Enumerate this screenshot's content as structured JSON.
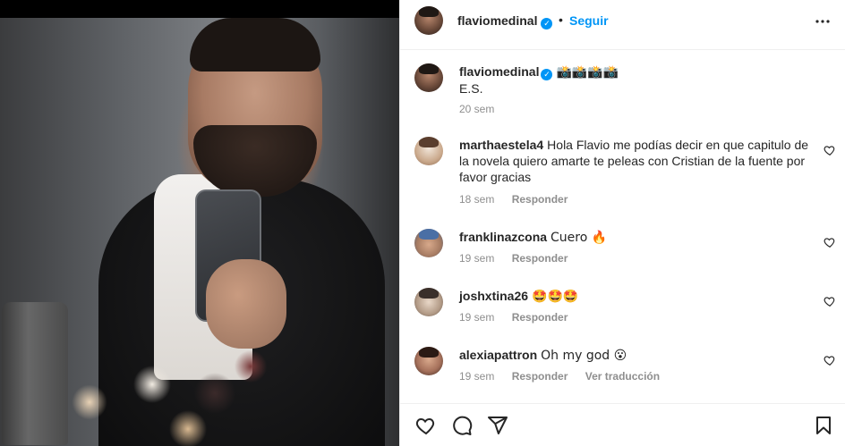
{
  "post": {
    "username": "flaviomedinal",
    "follow_label": "Seguir",
    "separator": "•",
    "caption": {
      "username": "flaviomedinal",
      "emojis": "📸📸📸📸",
      "text": "E.S.",
      "time": "20 sem"
    }
  },
  "comments": [
    {
      "username": "marthaestela4",
      "text": "Hola Flavio me podías decir en que capitulo de la novela quiero amarte te peleas con Cristian de la fuente por favor gracias",
      "time": "18 sem",
      "reply_label": "Responder"
    },
    {
      "username": "franklinazcona",
      "text": "Cuero 🔥",
      "time": "19 sem",
      "reply_label": "Responder"
    },
    {
      "username": "joshxtina26",
      "text": "🤩🤩🤩",
      "time": "19 sem",
      "reply_label": "Responder"
    },
    {
      "username": "alexiapattron",
      "text": "Oh my god 😮",
      "time": "19 sem",
      "reply_label": "Responder",
      "translate_label": "Ver traducción"
    }
  ],
  "icons": {
    "verified": "verified-badge-icon",
    "more": "more-options-icon",
    "like": "heart-icon",
    "comment": "comment-icon",
    "share": "share-icon",
    "save": "bookmark-icon"
  },
  "colors": {
    "accent": "#0095f6",
    "meta": "#8e8e8e",
    "text": "#262626"
  }
}
